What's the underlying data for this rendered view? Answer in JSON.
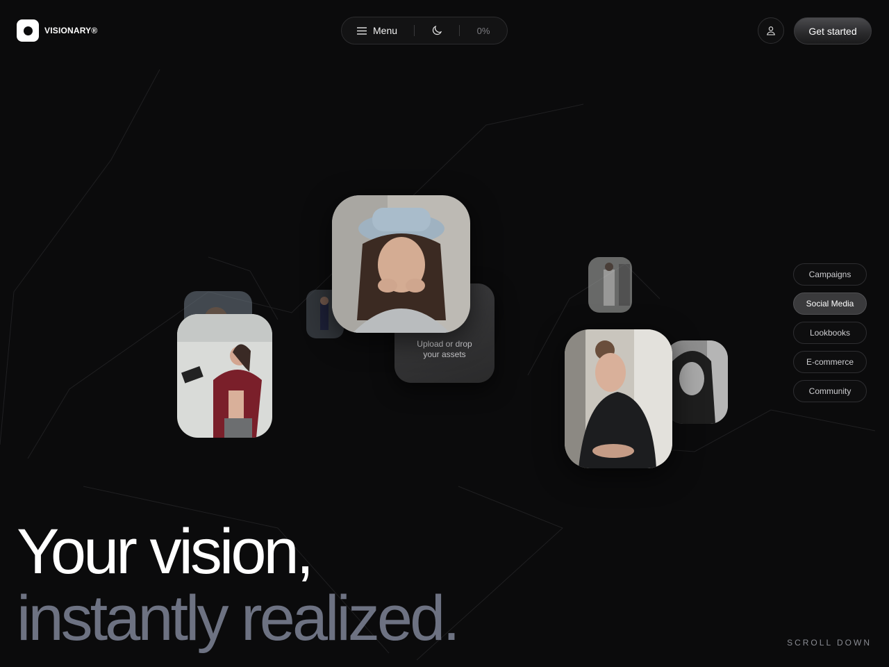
{
  "header": {
    "brand": "VISIONARY®",
    "menu_label": "Menu",
    "progress": "0%",
    "cta_label": "Get started"
  },
  "upload": {
    "line1": "Upload or drop",
    "line2": "your assets"
  },
  "categories": [
    "Campaigns",
    "Social Media",
    "Lookbooks",
    "E-commerce",
    "Community"
  ],
  "active_category": "Social Media",
  "hero": {
    "line1": "Your vision,",
    "line2": "instantly realized."
  },
  "scroll_label": "SCROLL DOWN",
  "colors": {
    "background": "#0b0b0c",
    "headline_secondary": "#6d7282",
    "accent_pill": "#3a3a3c"
  }
}
